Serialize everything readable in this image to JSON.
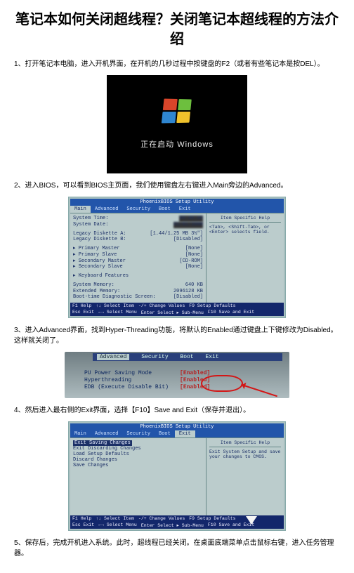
{
  "title": "笔记本如何关闭超线程？关闭笔记本超线程的方法介绍",
  "steps": {
    "s1": "1、打开笔记本电脑，进入开机界面，在开机的几秒过程中按键盘的F2（或者有些笔记本是按DEL）。",
    "s2": "2、进入BIOS，可以看到BIOS主页面，我们使用键盘左右键进入Main旁边的Advanced。",
    "s3": "3、进入Advanced界面，找到Hyper-Threading功能，将默认的Enabled通过键盘上下键修改为Disabled。这样就关闭了。",
    "s4": "4、然后进入最右侧的Exit界面，选择【F10】Save and Exit（保存并退出）。",
    "s5": "5、保存后，完成开机进入系统。此时，超线程已经关闭。在桌面底端菜单点击鼠标右键，进入任务管理器。"
  },
  "img1": {
    "text": "正在启动 Windows"
  },
  "bios": {
    "setup_title": "PhoenixBIOS Setup Utility",
    "menus": {
      "main": "Main",
      "advanced": "Advanced",
      "security": "Security",
      "boot": "Boot",
      "exit": "Exit"
    },
    "help_title": "Item Specific Help",
    "foot": {
      "f1": "F1  Help",
      "arrows": "↑↓ Select Item",
      "pm": "-/+  Change Values",
      "f9": "F9  Setup Defaults",
      "esc": "Esc Exit",
      "lr": "←→ Select Menu",
      "enter": "Enter Select ▸ Sub-Menu",
      "f10": "F10 Save and Exit"
    }
  },
  "img2": {
    "help_text": "<Tab>, <Shift-Tab>, or <Enter> selects field.",
    "rows": {
      "time_k": "System Time:",
      "date_k": "System Date:",
      "lda_k": "Legacy Diskette A:",
      "lda_v": "[1.44/1.25 MB  3½\"]",
      "ldb_k": "Legacy Diskette B:",
      "ldb_v": "[Disabled]",
      "pm_k": "Primary Master",
      "pm_v": "[None]",
      "ps_k": "Primary Slave",
      "ps_v": "[None]",
      "sm_k": "Secondary Master",
      "sm_v": "[CD-ROM]",
      "ss_k": "Secondary Slave",
      "ss_v": "[None]",
      "kf_k": "Keyboard Features",
      "smem_k": "System Memory:",
      "smem_v": "640 KB",
      "emem_k": "Extended Memory:",
      "emem_v": "2096128 KB",
      "diag_k": "Boot-time Diagnostic Screen:",
      "diag_v": "[Disabled]"
    }
  },
  "img3": {
    "rows": {
      "psm_k": "PU Power Saving Mode",
      "psm_v": "[Enabled]",
      "ht_k": "Hyperthreading",
      "ht_v": "[Enabled]",
      "edb_k": "EDB (Execute Disable Bit)",
      "edb_v": "[Enabled]"
    }
  },
  "img4": {
    "help_text": "Exit System Setup and save your changes to CMOS.",
    "rows": {
      "esc": "Exit Saving Changes",
      "edc": "Exit Discarding Changes",
      "lsd": "Load Setup Defaults",
      "dc": "Discard Changes",
      "sc": "Save Changes"
    }
  }
}
